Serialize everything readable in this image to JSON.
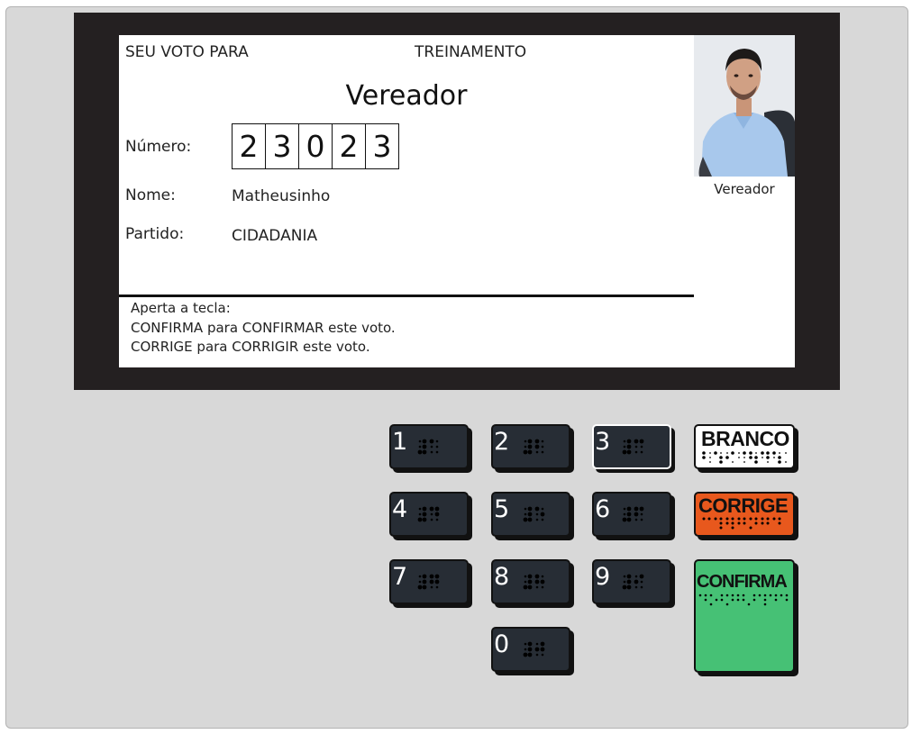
{
  "screen": {
    "header_left": "SEU VOTO PARA",
    "header_center": "TREINAMENTO",
    "office_title": "Vereador",
    "numero_label": "Número:",
    "digits": [
      "2",
      "3",
      "0",
      "2",
      "3"
    ],
    "nome_label": "Nome:",
    "nome_value": "Matheusinho",
    "partido_label": "Partido:",
    "partido_value": "CIDADANIA",
    "photo_caption": "Vereador",
    "instructions": {
      "line1": "Aperta a tecla:",
      "line2": "CONFIRMA para CONFIRMAR este voto.",
      "line3": "CORRIGE para CORRIGIR este voto."
    }
  },
  "keypad": {
    "keys": [
      {
        "label": "1"
      },
      {
        "label": "2"
      },
      {
        "label": "3",
        "pressed": true
      },
      {
        "label": "4"
      },
      {
        "label": "5"
      },
      {
        "label": "6"
      },
      {
        "label": "7"
      },
      {
        "label": "8"
      },
      {
        "label": "9"
      },
      {
        "label": "0"
      }
    ],
    "branco_label": "BRANCO",
    "corrige_label": "CORRIGE",
    "confirma_label": "CONFIRMA"
  },
  "colors": {
    "bezel": "#242021",
    "key": "#272d35",
    "branco": "#ffffff",
    "corrige": "#e8581d",
    "confirma": "#46c175"
  }
}
